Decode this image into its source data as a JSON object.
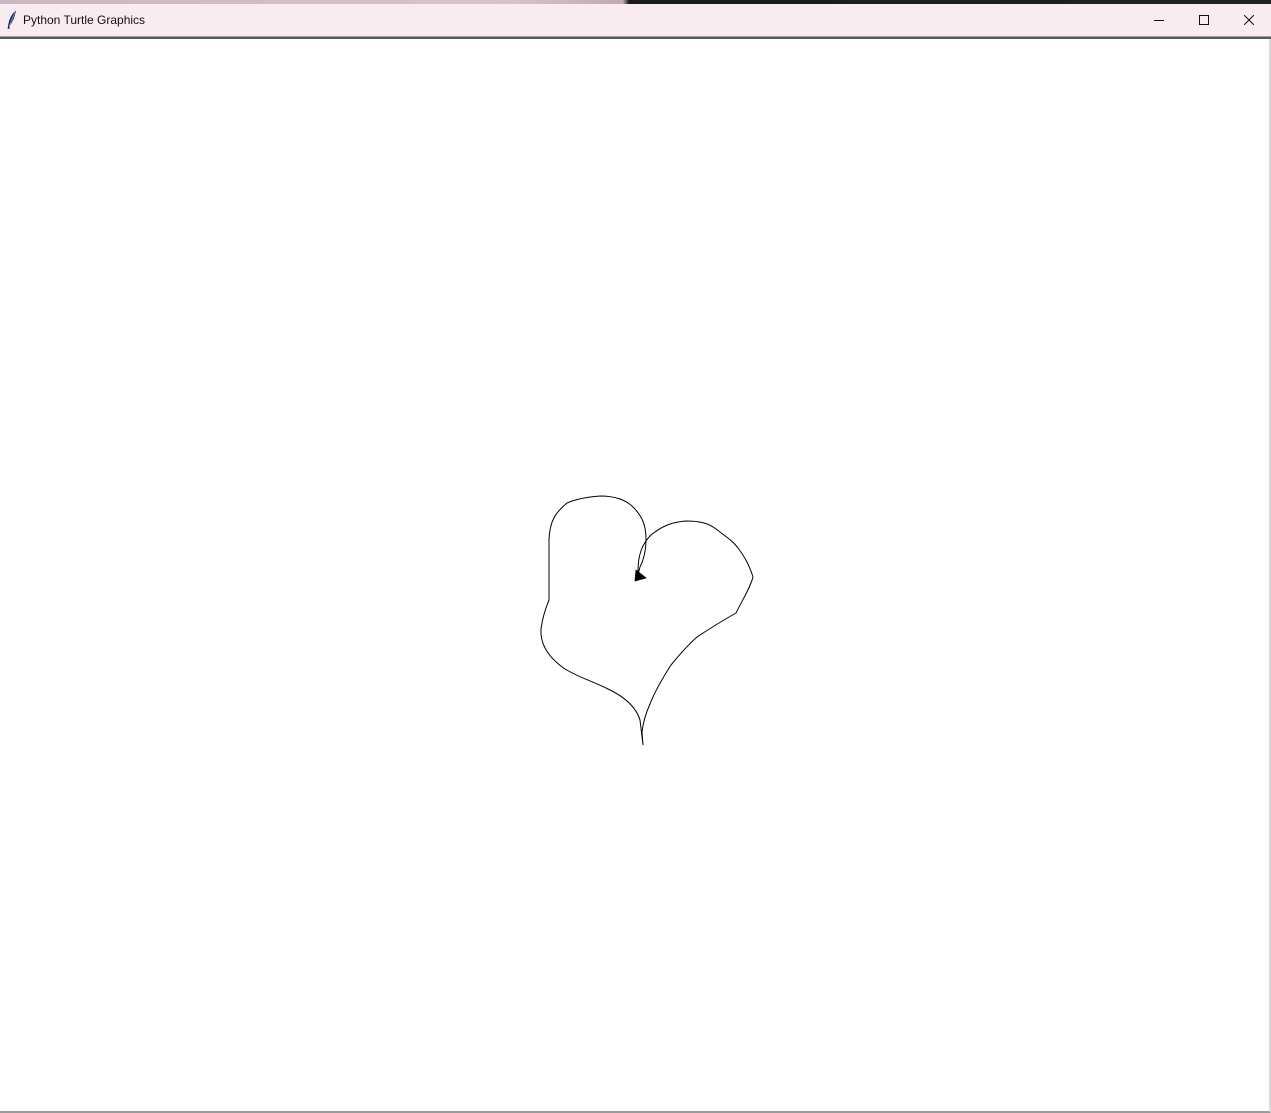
{
  "window": {
    "title": "Python Turtle Graphics",
    "app_icon": "feather-icon",
    "controls": {
      "minimize_icon": "minimize-icon",
      "maximize_icon": "maximize-icon",
      "close_icon": "close-icon"
    }
  },
  "canvas": {
    "background": "#ffffff",
    "pen_color": "#000000",
    "drawing": "heart-outline",
    "turtle_icon": "turtle-arrow-icon"
  }
}
